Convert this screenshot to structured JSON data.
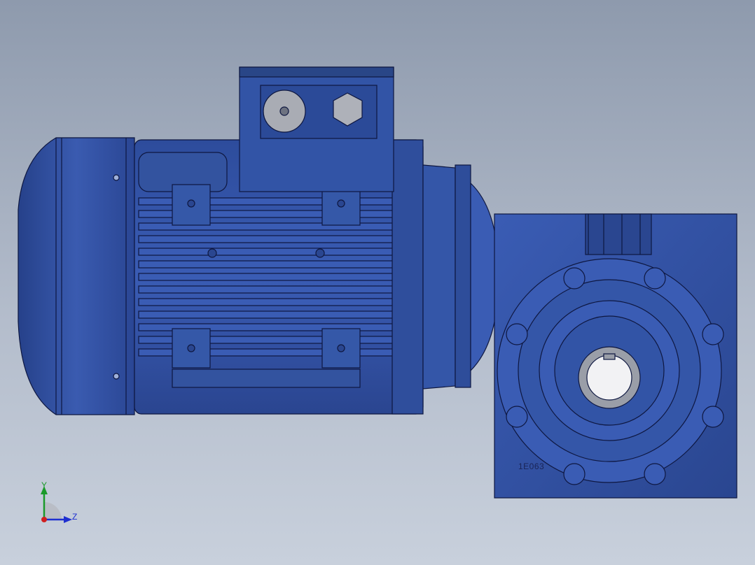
{
  "viewport": {
    "background_top": "#8e9aad",
    "background_bottom": "#c8d0dc",
    "model_color": "#2f4f9e",
    "edge_color": "#0e1740"
  },
  "model": {
    "parts": [
      "motor-fan-cover",
      "motor-housing",
      "terminal-box",
      "cable-gland",
      "hex-plug",
      "adapter-flange",
      "worm-gearbox",
      "output-hollow-shaft"
    ],
    "gearbox_marking": "1E063"
  },
  "triad": {
    "y_label": "Y",
    "z_label": "Z",
    "y_color": "#1a9a2a",
    "z_color": "#1e2fd0",
    "origin_color": "#d02020"
  }
}
